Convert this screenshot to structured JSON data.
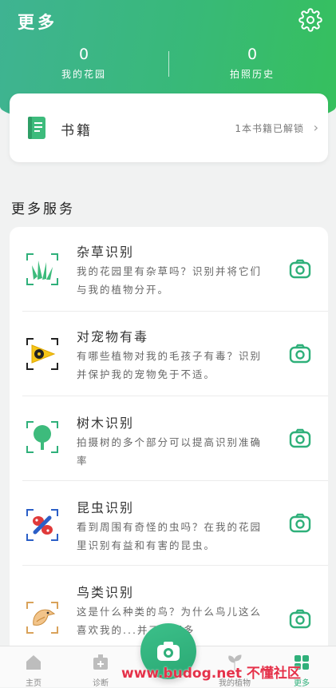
{
  "header": {
    "title": "更多",
    "stats": [
      {
        "value": "0",
        "label": "我的花园"
      },
      {
        "value": "0",
        "label": "拍照历史"
      }
    ]
  },
  "book": {
    "title": "书籍",
    "status": "1本书籍已解锁",
    "chevron": "›"
  },
  "section_title": "更多服务",
  "services": [
    {
      "icon": "grass-icon",
      "title": "杂草识别",
      "desc": "我的花园里有杂草吗？识别并将它们与我的植物分开。"
    },
    {
      "icon": "toxic-pet-icon",
      "title": "对宠物有毒",
      "desc": "有哪些植物对我的毛孩子有毒？识别并保护我的宠物免于不适。"
    },
    {
      "icon": "tree-icon",
      "title": "树木识别",
      "desc": "拍摄树的多个部分可以提高识别准确率"
    },
    {
      "icon": "insect-icon",
      "title": "昆虫识别",
      "desc": "看到周围有奇怪的虫吗？在我的花园里识别有益和有害的昆虫。"
    },
    {
      "icon": "bird-icon",
      "title": "鸟类识别",
      "desc": "这是什么种类的鸟？为什么鸟儿这么喜欢我的...并了解更多"
    }
  ],
  "nav": [
    {
      "label": "主页",
      "icon": "home-icon"
    },
    {
      "label": "诊断",
      "icon": "diagnose-icon"
    },
    {
      "label": "我的植物",
      "icon": "plant-icon"
    },
    {
      "label": "更多",
      "icon": "more-icon"
    }
  ],
  "watermark": "www.budog.net 不懂社区",
  "colors": {
    "accent": "#2fb07a",
    "header_start": "#3fb392",
    "header_end": "#36c05d"
  }
}
